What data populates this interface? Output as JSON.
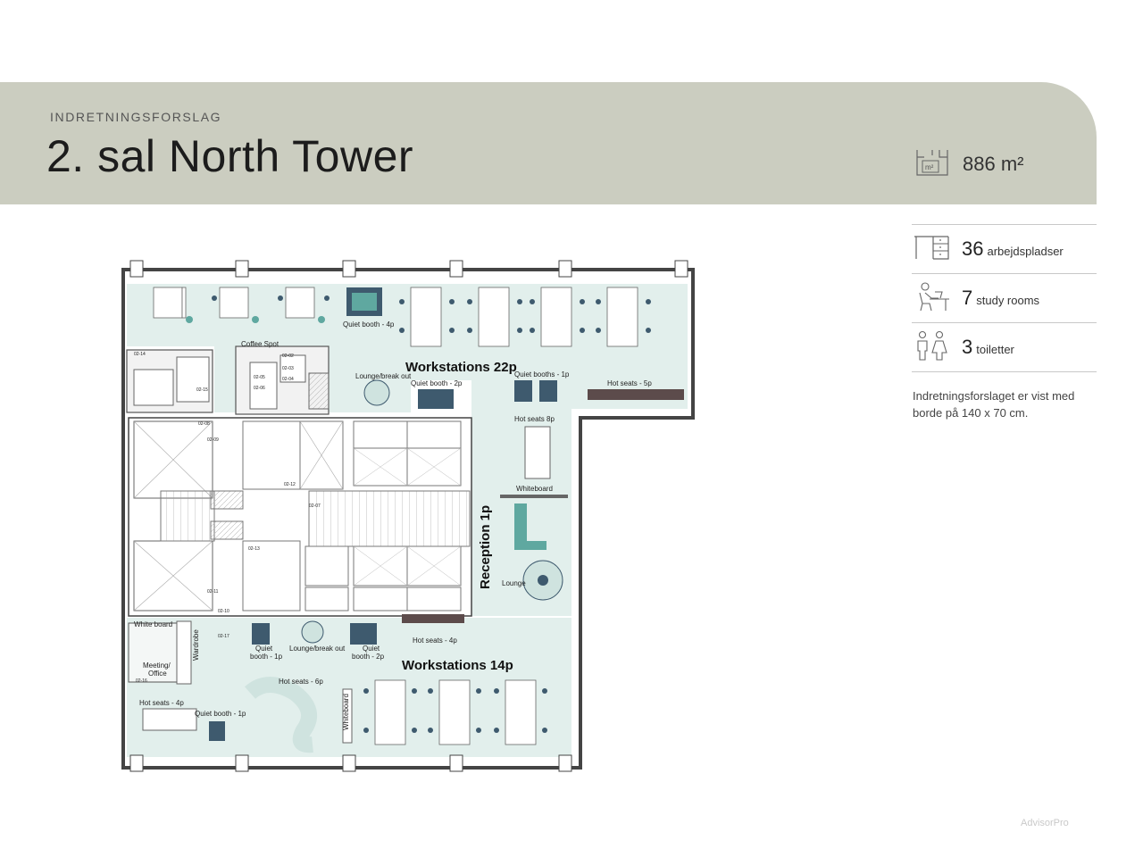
{
  "header": {
    "eyebrow": "INDRETNINGSFORSLAG",
    "title": "2. sal North Tower",
    "area": "886 m²"
  },
  "stats": [
    {
      "icon": "desk-icon",
      "number": "36",
      "label": "arbejdspladser"
    },
    {
      "icon": "study-room-icon",
      "number": "7",
      "label": "study rooms"
    },
    {
      "icon": "toilet-icon",
      "number": "3",
      "label": "toiletter"
    }
  ],
  "note": "Indretningsforslaget er vist med borde på 140 x 70 cm.",
  "plan": {
    "labels": {
      "workstations_22": "Workstations 22p",
      "workstations_14": "Workstations 14p",
      "reception": "Reception 1p",
      "coffee": "Coffee Spot",
      "quiet_booth_4": "Quiet booth - 4p",
      "lounge_break_top": "Lounge/break out",
      "quiet_booth_2_top": "Quiet booth - 2p",
      "quiet_booths_1": "Quiet booths - 1p",
      "hot_seats_5": "Hot seats - 5p",
      "hot_seats_8": "Hot seats 8p",
      "whiteboard_right": "Whiteboard",
      "lounge": "Lounge",
      "white_board_left": "White board",
      "wardrobe": "Wardrobe",
      "meeting": "Meeting/",
      "office": "Office",
      "quiet_1_bottom_a": "Quiet",
      "quiet_1_bottom_b": "booth - 1p",
      "lounge_break_bottom": "Lounge/break out",
      "quiet_2_bottom_a": "Quiet",
      "quiet_2_bottom_b": "booth - 2p",
      "hot_seats_4_mid": "Hot seats - 4p",
      "hot_seats_6": "Hot seats - 6p",
      "whiteboard_bottom": "Whiteboard",
      "hot_seats_4_left": "Hot seats - 4p",
      "quiet_booth_1_left": "Quiet booth - 1p"
    },
    "room_codes": [
      "02-14",
      "02-15",
      "02-08",
      "02-09",
      "02-02",
      "02-03",
      "02-04",
      "02-05",
      "02-06",
      "02-12",
      "02-07",
      "02-13",
      "02-11",
      "02-10",
      "02-17",
      "02-16"
    ]
  },
  "watermark": "AdvisorPro",
  "colors": {
    "banner": "#cbcdc0",
    "floor": "#e2efec",
    "accent_dark": "#3e5a6e",
    "accent_teal": "#5fa8a0"
  }
}
